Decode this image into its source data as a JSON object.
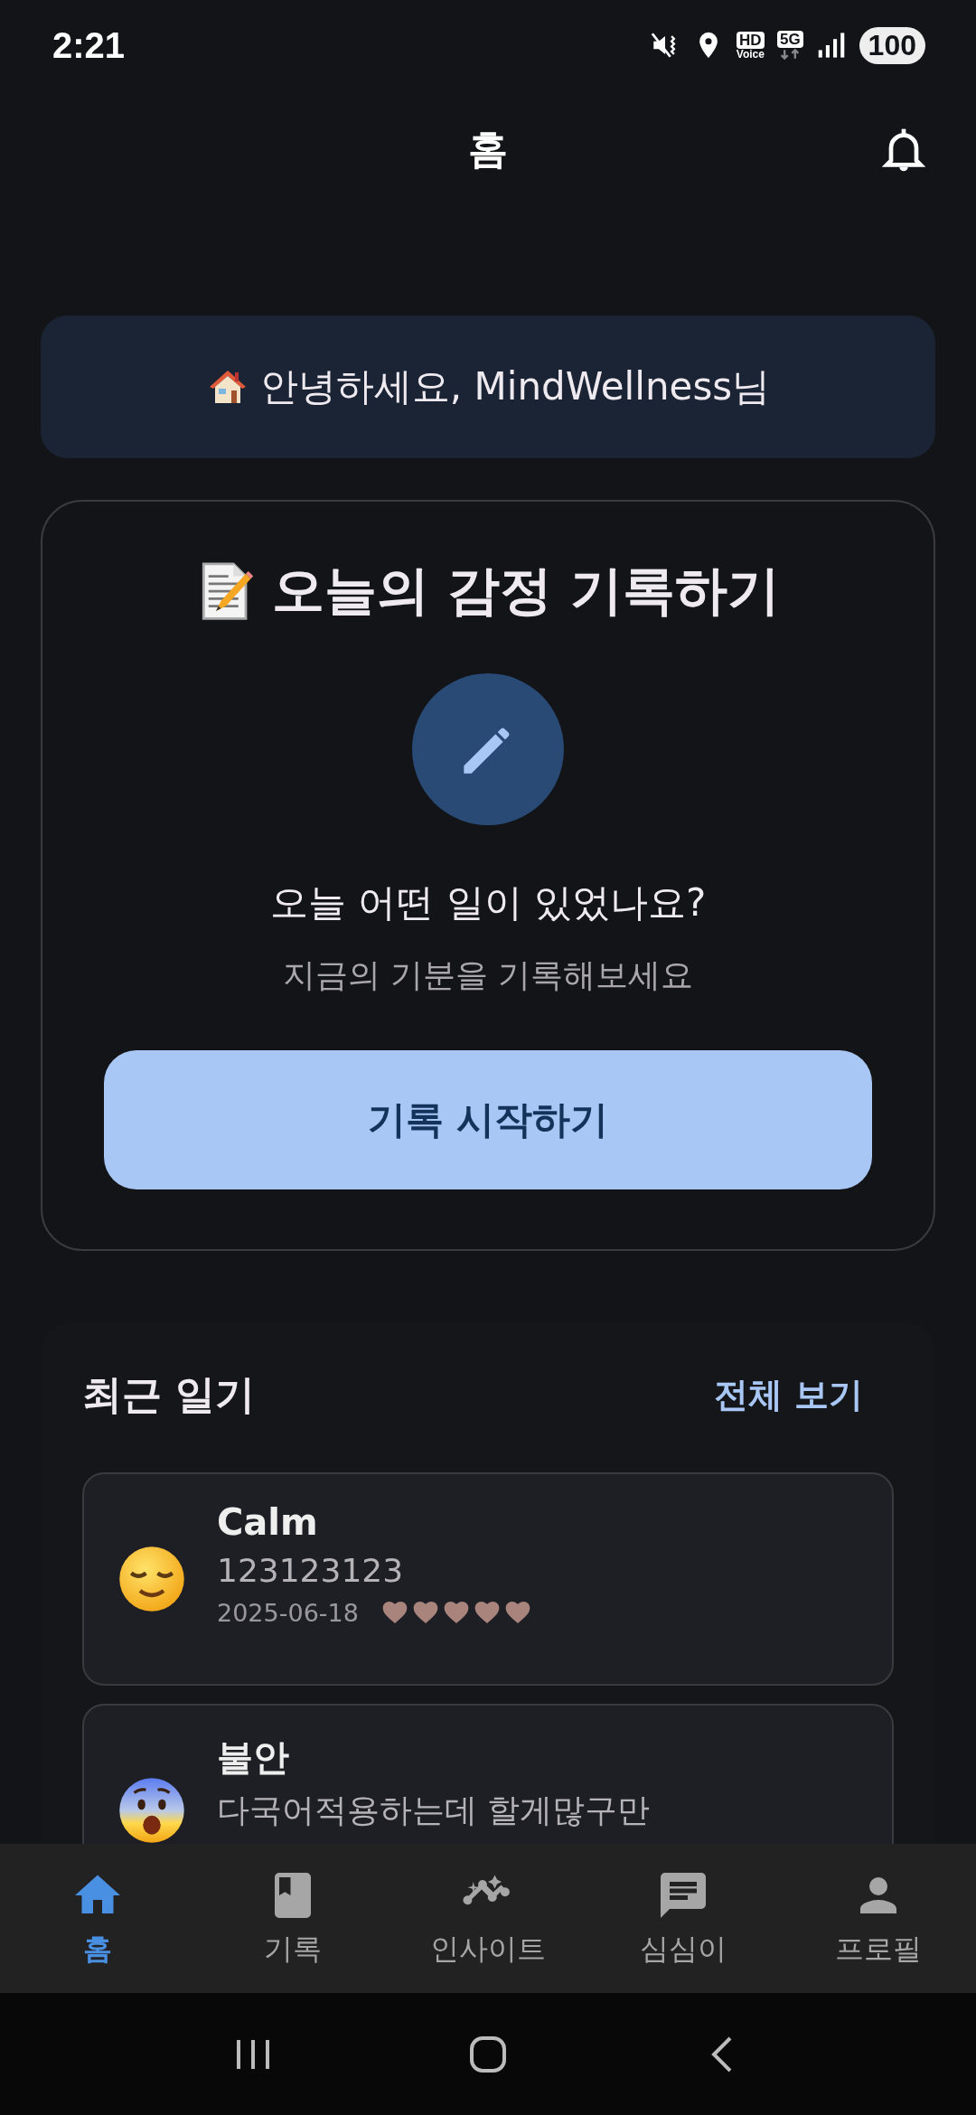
{
  "status_bar": {
    "time": "2:21",
    "hd": "HD",
    "voice": "Voice",
    "network": "5G",
    "battery": "100"
  },
  "header": {
    "title": "홈"
  },
  "greeting": {
    "text": "안녕하세요, MindWellness님"
  },
  "record_card": {
    "title": "오늘의 감정 기록하기",
    "question": "오늘 어떤 일이 있었나요?",
    "subtitle": "지금의 기분을 기록해보세요",
    "button": "기록 시작하기"
  },
  "recent": {
    "title": "최근 일기",
    "view_all": "전체 보기",
    "entries": [
      {
        "kind": "calm",
        "title": "Calm",
        "text": "123123123",
        "date": "2025-06-18",
        "stars": 5
      },
      {
        "kind": "anxious",
        "title": "불안",
        "text": "다국어적용하는데 할게많구만"
      }
    ]
  },
  "bottom_nav": [
    {
      "kind": "home",
      "label": "홈",
      "selected": true
    },
    {
      "kind": "book",
      "label": "기록",
      "selected": false
    },
    {
      "kind": "insight",
      "label": "인사이트",
      "selected": false
    },
    {
      "kind": "chat",
      "label": "심심이",
      "selected": false
    },
    {
      "kind": "person",
      "label": "프로필",
      "selected": false
    }
  ]
}
